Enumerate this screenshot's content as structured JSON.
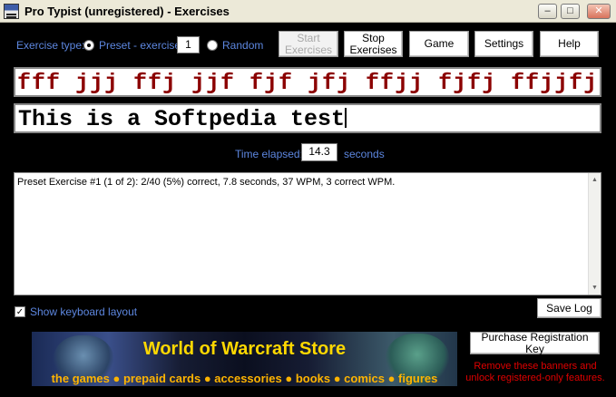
{
  "window": {
    "title": "Pro Typist (unregistered) - Exercises",
    "controls": {
      "minimize": "–",
      "maximize": "□",
      "close": "✕"
    }
  },
  "exercise_type": {
    "label": "Exercise type:",
    "preset_label": "Preset - exercise:",
    "preset_value": "1",
    "random_label": "Random",
    "selected": "preset"
  },
  "toolbar": {
    "start_label": "Start Exercises",
    "stop_label": "Stop Exercises",
    "game_label": "Game",
    "settings_label": "Settings",
    "help_label": "Help"
  },
  "target_text": "fff jjj ffj jjf fjf jfj ffjj fjfj ffjjfj",
  "typed_text": "This is a Softpedia test",
  "timer": {
    "label": "Time elapsed:",
    "value": "14.3",
    "unit": "seconds"
  },
  "log": {
    "text": "Preset Exercise #1 (1 of 2): 2/40 (5%) correct, 7.8 seconds, 37 WPM, 3 correct WPM."
  },
  "keyboard_layout": {
    "label": "Show keyboard layout",
    "checked": true
  },
  "save_log_label": "Save Log",
  "banner": {
    "title": "World of Warcraft Store",
    "subtitle": "the games ● prepaid cards ● accessories ● books ● comics ● figures"
  },
  "purchase_label": "Purchase Registration Key",
  "promo_text": "Remove these banners and unlock registered-only features.",
  "colors": {
    "background": "#000000",
    "label_blue": "#5d87e0",
    "target_text": "#8b0000",
    "promo_red": "#e00000",
    "banner_gold": "#ffd800"
  }
}
